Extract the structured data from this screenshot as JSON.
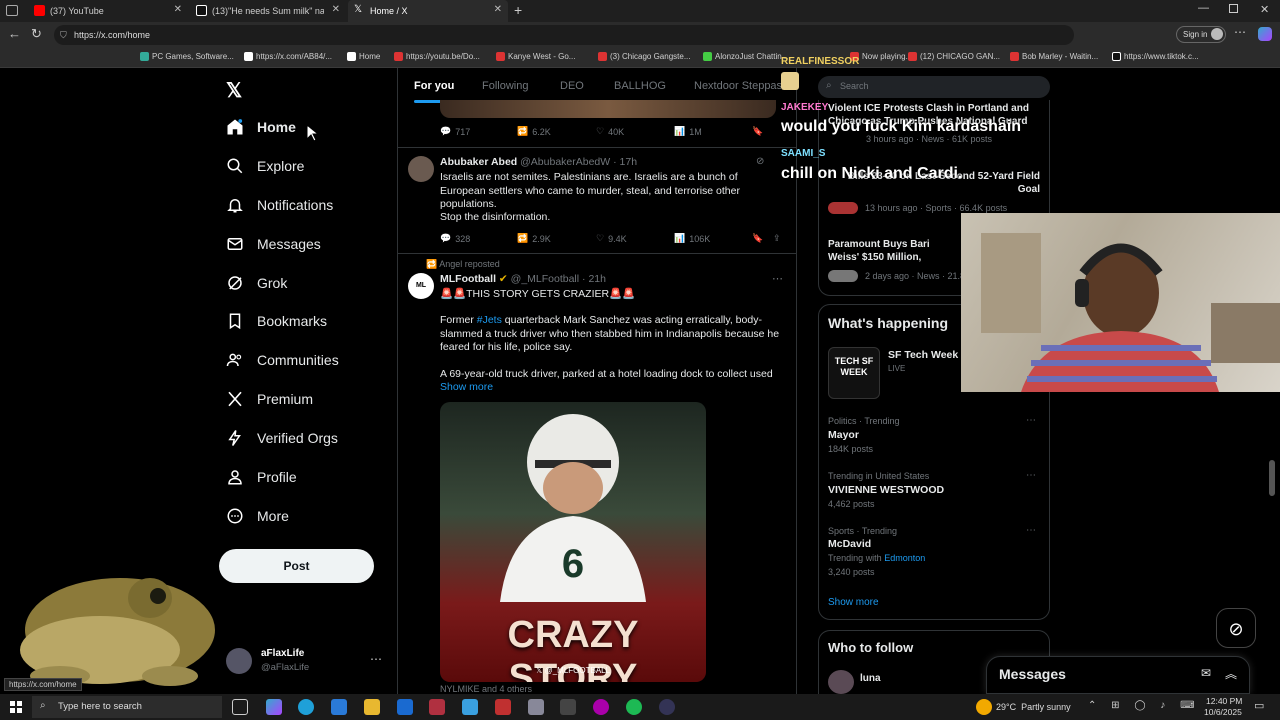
{
  "browser": {
    "tabs": [
      {
        "title": "(37) YouTube"
      },
      {
        "title": "(13)\"He needs Sum milk\" nahh Fr..."
      },
      {
        "title": "Home / X"
      }
    ],
    "url": "https://x.com/home",
    "sign_in": "Sign in",
    "bookmarks": [
      "PC Games, Software...",
      "https://x.com/AB84/...",
      "Home",
      "https://youtu.be/Do...",
      "Kanye West - Go...",
      "(3) Chicago Gangste...",
      "AlonzoJust Chattin...",
      "Now playing...",
      "(12) CHICAGO GAN...",
      "Bob Marley - Waitin...",
      "https://www.tiktok.c..."
    ],
    "status_url": "https://x.com/home"
  },
  "nav": {
    "items": [
      {
        "label": "Home"
      },
      {
        "label": "Explore"
      },
      {
        "label": "Notifications"
      },
      {
        "label": "Messages"
      },
      {
        "label": "Grok"
      },
      {
        "label": "Bookmarks"
      },
      {
        "label": "Communities"
      },
      {
        "label": "Premium"
      },
      {
        "label": "Verified Orgs"
      },
      {
        "label": "Profile"
      },
      {
        "label": "More"
      }
    ],
    "post_button": "Post",
    "account": {
      "name": "aFlaxLife",
      "handle": "@aFlaxLife"
    }
  },
  "feed": {
    "tabs": [
      "For you",
      "Following",
      "DEO",
      "BALLHOG",
      "Nextdoor Steppas"
    ],
    "top_metrics": {
      "replies": "717",
      "reposts": "6.2K",
      "likes": "40K",
      "views": "1M"
    },
    "tweet1": {
      "name": "Abubaker Abed",
      "handle": "@AbubakerAbedW",
      "time": "17h",
      "text": "Israelis are not semites. Palestinians are. Israelis are a bunch of European settlers who came to murder, steal, and terrorise other populations.",
      "text2": "Stop the disinformation.",
      "replies": "328",
      "reposts": "2.9K",
      "likes": "9.4K",
      "views": "106K"
    },
    "tweet2": {
      "repost_note": "Angel reposted",
      "name": "MLFootball",
      "handle": "@_MLFootball",
      "time": "21h",
      "headline": "🚨🚨THIS STORY GETS CRAZIER🚨🚨",
      "para1_before": "Former ",
      "hashtag": "#Jets",
      "para1_after": " quarterback Mark Sanchez was acting erratically, body-slammed a truck driver who then stabbed him in Indianapolis because he feared for his life, police say.",
      "para2": "A 69-year-old truck driver, parked at a hotel loading dock to collect used",
      "show_more": "Show more",
      "image_title": "CRAZY STORY",
      "image_credit": "@_MLFOOTBALL",
      "liked_by": "NYLMIKE and 4 others"
    }
  },
  "right": {
    "search_placeholder": "Search",
    "news": [
      {
        "title": "Violent ICE Protests Clash in Portland and Chicago as Trump Pushes National Guard",
        "meta": "3 hours ago · News · 61K posts"
      },
      {
        "title": "Bills 23-20 on Last-Second 52-Yard Field Goal",
        "meta": "13 hours ago · Sports · 66.4K posts"
      },
      {
        "title": "Paramount Buys Bari Weiss' $150 Million, Appoints Her C",
        "meta": "2 days ago · News · 21.8K"
      }
    ],
    "whats_happening": "What's happening",
    "event": {
      "title": "SF Tech Week 2",
      "status": "LIVE",
      "logo": "TECH SF WEEK"
    },
    "trends": [
      {
        "context": "Politics · Trending",
        "name": "Mayor",
        "posts": "184K posts"
      },
      {
        "context": "Trending in United States",
        "name": "VIVIENNE WESTWOOD",
        "posts": "4,462 posts"
      },
      {
        "context": "Sports · Trending",
        "name": "McDavid",
        "extra_prefix": "Trending with ",
        "extra_link": "Edmonton",
        "posts": "3,240 posts"
      }
    ],
    "show_more": "Show more",
    "who_to_follow": "Who to follow",
    "follow_name": "luna",
    "messages": "Messages"
  },
  "stream_chat": [
    {
      "user": "REALFINESSOR",
      "color": "#f0d060",
      "msg": ""
    },
    {
      "user": "JAKEKEY",
      "color": "#ff7ad0",
      "msg": "would you fuck Kim kardashain"
    },
    {
      "user": "SAAMI_S",
      "color": "#7ee0ff",
      "msg": "chill on Nicki and Cardi."
    }
  ],
  "taskbar": {
    "search": "Type here to search",
    "weather": "29°C  Partly sunny",
    "time": "12:40 PM",
    "date": "10/6/2025"
  },
  "colors": {
    "accent": "#1d9bf0",
    "background": "#000000",
    "text_muted": "#71767b"
  }
}
